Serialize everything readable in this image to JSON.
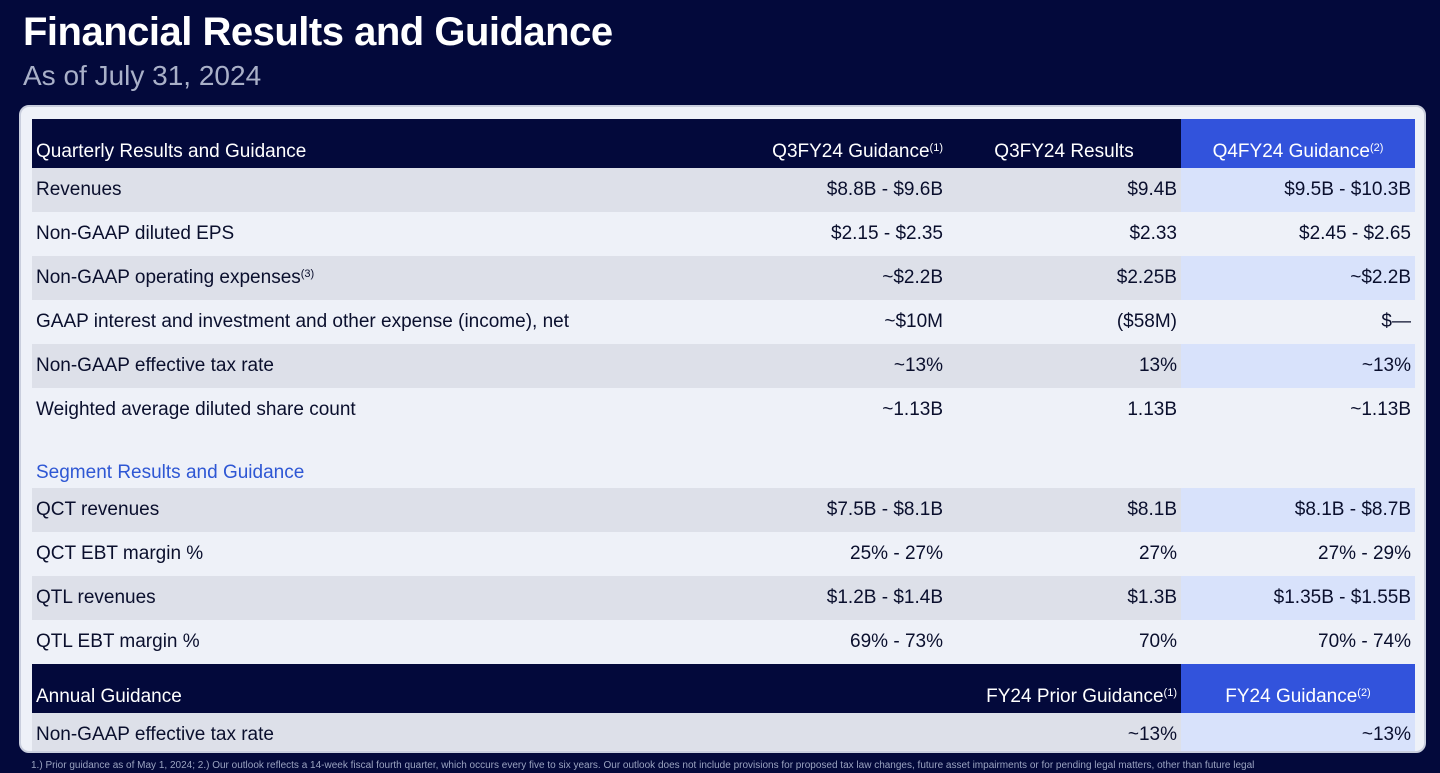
{
  "title": "Financial Results and Guidance",
  "subtitle": "As of July 31, 2024",
  "quarterly": {
    "header": {
      "label": "Quarterly Results and Guidance",
      "col1": "Q3FY24 Guidance",
      "col1_sup": "(1)",
      "col2": "Q3FY24 Results",
      "col3": "Q4FY24 Guidance",
      "col3_sup": "(2)"
    },
    "rows": [
      {
        "label": "Revenues",
        "sup": "",
        "c1": "$8.8B - $9.6B",
        "c2": "$9.4B",
        "c3": "$9.5B - $10.3B"
      },
      {
        "label": "Non-GAAP diluted EPS",
        "sup": "",
        "c1": "$2.15 - $2.35",
        "c2": "$2.33",
        "c3": "$2.45 - $2.65"
      },
      {
        "label": "Non-GAAP operating expenses",
        "sup": "(3)",
        "c1": "~$2.2B",
        "c2": "$2.25B",
        "c3": "~$2.2B"
      },
      {
        "label": "GAAP interest and investment and other expense (income), net",
        "sup": "",
        "c1": "~$10M",
        "c2": "($58M)",
        "c3": "$—"
      },
      {
        "label": "Non-GAAP effective tax rate",
        "sup": "",
        "c1": "~13%",
        "c2": "13%",
        "c3": "~13%"
      },
      {
        "label": "Weighted average diluted share count",
        "sup": "",
        "c1": "~1.13B",
        "c2": "1.13B",
        "c3": "~1.13B"
      }
    ]
  },
  "segment": {
    "heading": "Segment Results and Guidance",
    "rows": [
      {
        "label": "QCT revenues",
        "c1": "$7.5B - $8.1B",
        "c2": "$8.1B",
        "c3": "$8.1B - $8.7B"
      },
      {
        "label": "QCT EBT margin %",
        "c1": "25% - 27%",
        "c2": "27%",
        "c3": "27% - 29%"
      },
      {
        "label": "QTL revenues",
        "c1": "$1.2B - $1.4B",
        "c2": "$1.3B",
        "c3": "$1.35B - $1.55B"
      },
      {
        "label": "QTL EBT margin %",
        "c1": "69% - 73%",
        "c2": "70%",
        "c3": "70% - 74%"
      }
    ]
  },
  "annual": {
    "header": {
      "label": "Annual Guidance",
      "col2": "FY24 Prior Guidance",
      "col2_sup": "(1)",
      "col3": "FY24 Guidance",
      "col3_sup": "(2)"
    },
    "rows": [
      {
        "label": "Non-GAAP effective tax rate",
        "c2": "~13%",
        "c3": "~13%"
      }
    ]
  },
  "footnote": "1.) Prior guidance as of May 1, 2024; 2.) Our outlook reflects a 14-week fiscal fourth quarter, which occurs every five to six years. Our outlook does not include provisions for proposed tax law changes, future asset impairments or for pending legal matters, other than future legal",
  "colors": {
    "background": "#03093b",
    "header_highlight": "#3253dc",
    "section_heading": "#2e57d4",
    "row_shade": "#dde0e9",
    "highlight_cell": "#d8e2fb"
  }
}
